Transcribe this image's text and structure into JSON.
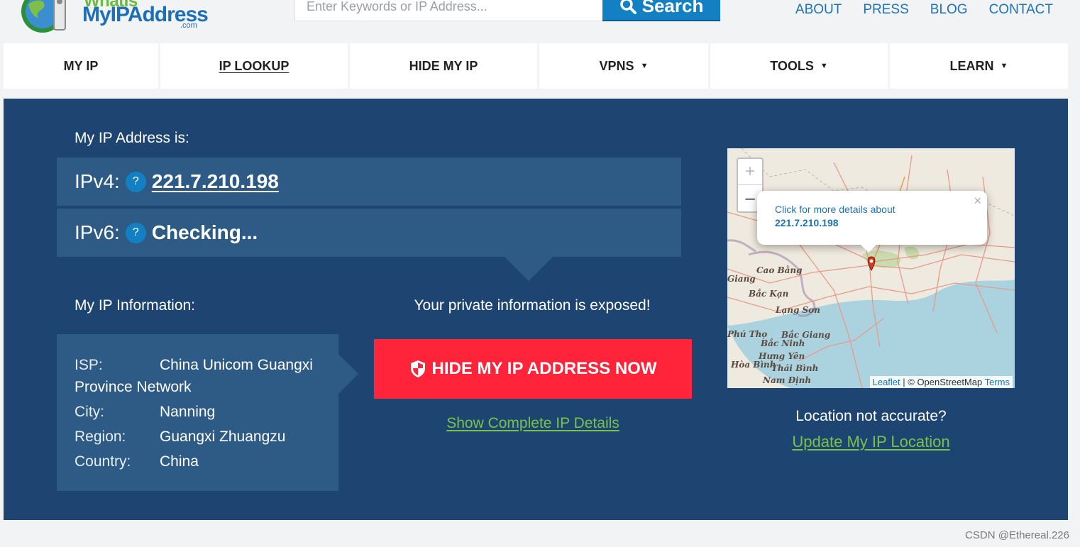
{
  "logo": {
    "top_text": "WhatIs",
    "main_text": "MyIPAddress",
    "suffix": ".com"
  },
  "search": {
    "placeholder": "Enter Keywords or IP Address...",
    "button_label": "Search"
  },
  "top_links": [
    "ABOUT",
    "PRESS",
    "BLOG",
    "CONTACT"
  ],
  "nav": {
    "items": [
      {
        "label": "MY IP",
        "caret": ""
      },
      {
        "label": "IP LOOKUP",
        "caret": ""
      },
      {
        "label": "HIDE MY IP",
        "caret": ""
      },
      {
        "label": "VPNS",
        "caret": "▼"
      },
      {
        "label": "TOOLS",
        "caret": "▼"
      },
      {
        "label": "LEARN",
        "caret": "▼"
      }
    ]
  },
  "main": {
    "address_heading": "My IP Address is:",
    "ipv4_label": "IPv4:",
    "ipv4_value": "221.7.210.198",
    "ipv6_label": "IPv6:",
    "ipv6_value": "Checking...",
    "help_glyph": "?",
    "info_heading": "My IP Information:",
    "info": {
      "isp_label": "ISP:",
      "isp_value": "China Unicom Guangxi",
      "isp_value_cont": "Province Network",
      "city_label": "City:",
      "city_value": "Nanning",
      "region_label": "Region:",
      "region_value": "Guangxi Zhuangzu",
      "country_label": "Country:",
      "country_value": "China"
    },
    "exposed_text": "Your private information is exposed!",
    "hide_button_label": "HIDE MY IP ADDRESS NOW",
    "complete_details_link": "Show Complete IP Details"
  },
  "map": {
    "zoom_in": "+",
    "zoom_out": "–",
    "popup_text": "Click for more details about",
    "popup_ip": "221.7.210.198",
    "popup_close": "×",
    "places": [
      "Cao Bằng",
      "Giang",
      "Bắc Kạn",
      "Lạng Sơn",
      "Phú Thọ",
      "Bắc Giang",
      "Bắc Ninh",
      "Hưng Yên",
      "Hòa Bình",
      "Thái Bình",
      "Nam Định"
    ],
    "attribution_leaflet": "Leaflet",
    "attribution_sep": " | © OpenStreetMap ",
    "attribution_terms": "Terms"
  },
  "location": {
    "not_accurate": "Location not accurate?",
    "update_link": "Update My IP Location"
  },
  "watermark": "CSDN @Ethereal.226",
  "colors": {
    "panel": "#1e4571",
    "row": "#2d5b85",
    "accent_blue": "#1380c4",
    "cta_red": "#ff2439",
    "link_green": "#7cc04b"
  }
}
